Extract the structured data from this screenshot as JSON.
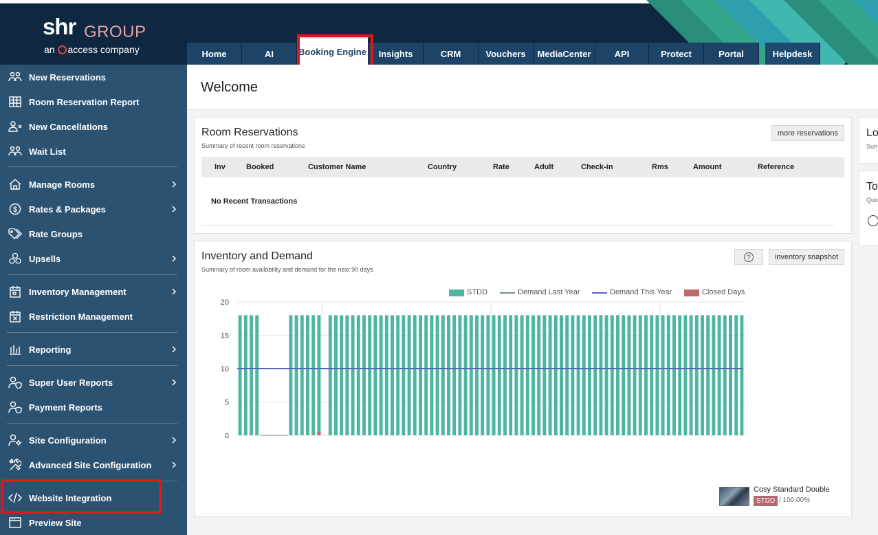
{
  "brand": {
    "name_main": "shr",
    "name_group": "GROUP",
    "tagline_pre": "an",
    "tagline_post": "access company"
  },
  "topnav": {
    "tabs": [
      {
        "label": "Home"
      },
      {
        "label": "AI"
      },
      {
        "label": "Booking Engine",
        "active": true
      },
      {
        "label": "Insights"
      },
      {
        "label": "CRM"
      },
      {
        "label": "Vouchers"
      },
      {
        "label": "MediaCenter"
      },
      {
        "label": "API"
      },
      {
        "label": "Protect"
      },
      {
        "label": "Portal"
      },
      {
        "label": "Helpdesk"
      }
    ]
  },
  "sidebar": {
    "items": [
      {
        "label": "New Reservations",
        "icon": "users-icon",
        "chevron": false
      },
      {
        "label": "Room Reservation Report",
        "icon": "table-icon",
        "chevron": false
      },
      {
        "label": "New Cancellations",
        "icon": "user-x-icon",
        "chevron": false
      },
      {
        "label": "Wait List",
        "icon": "users-icon",
        "chevron": false
      },
      {
        "label": "Manage Rooms",
        "icon": "home-icon",
        "chevron": true
      },
      {
        "label": "Rates & Packages",
        "icon": "dollar-circle-icon",
        "chevron": true
      },
      {
        "label": "Rate Groups",
        "icon": "tag-icon",
        "chevron": false
      },
      {
        "label": "Upsells",
        "icon": "boxes-icon",
        "chevron": true
      },
      {
        "label": "Inventory Management",
        "icon": "calendar-icon",
        "chevron": true
      },
      {
        "label": "Restriction Management",
        "icon": "calendar-x-icon",
        "chevron": false
      },
      {
        "label": "Reporting",
        "icon": "bar-chart-icon",
        "chevron": true
      },
      {
        "label": "Super User Reports",
        "icon": "user-shield-icon",
        "chevron": true
      },
      {
        "label": "Payment Reports",
        "icon": "user-shield-icon",
        "chevron": false
      },
      {
        "label": "Site Configuration",
        "icon": "user-gear-icon",
        "chevron": true
      },
      {
        "label": "Advanced Site Configuration",
        "icon": "tools-icon",
        "chevron": true
      },
      {
        "label": "Website Integration",
        "icon": "code-icon",
        "chevron": false
      },
      {
        "label": "Preview Site",
        "icon": "browser-icon",
        "chevron": false
      }
    ]
  },
  "welcome": {
    "title": "Welcome"
  },
  "reservations": {
    "title": "Room Reservations",
    "subtitle": "Summary of recent room reservations",
    "more_button": "more reservations",
    "columns": [
      "Inv",
      "Booked",
      "Customer Name",
      "Country",
      "Rate",
      "Adult",
      "Check-in",
      "Rms",
      "Amount",
      "Reference"
    ],
    "empty_text": "No Recent Transactions"
  },
  "inventory": {
    "title": "Inventory and Demand",
    "subtitle": "Summary of room availability and demand for the next 90 days",
    "help_icon": "help-circle-icon",
    "snapshot_button": "inventory snapshot",
    "room": {
      "name": "Cosy Standard Double",
      "code": "STDD",
      "percent": "/ 100.00%"
    }
  },
  "right_panels": [
    {
      "title": "Lo",
      "subtitle": "Sun"
    },
    {
      "title": "To",
      "subtitle": "Quic"
    }
  ],
  "colors": {
    "header_bg": "#0d2840",
    "sidebar_bg": "#2c5272",
    "tab_bg": "#1d4467",
    "bar": "#4db6a0",
    "demand_last_year": "#7a8b8a",
    "demand_this_year": "#5565c0",
    "closed_days": "#c06a6e",
    "highlight": "#e3141b"
  },
  "chart_data": {
    "type": "bar",
    "ylim": [
      0,
      20
    ],
    "yticks": [
      0,
      5,
      10,
      15,
      20
    ],
    "grid": true,
    "legend_position": "top-right",
    "series": [
      {
        "name": "STDD",
        "type": "bar",
        "values": [
          18,
          18,
          18,
          18,
          0,
          0,
          0,
          0,
          0,
          18,
          18,
          18,
          18,
          18,
          18,
          0,
          18,
          18,
          18,
          18,
          18,
          18,
          18,
          18,
          18,
          18,
          18,
          18,
          18,
          18,
          18,
          18,
          18,
          18,
          18,
          18,
          18,
          18,
          18,
          18,
          18,
          18,
          18,
          18,
          18,
          18,
          18,
          18,
          18,
          18,
          18,
          18,
          18,
          18,
          18,
          18,
          18,
          18,
          18,
          18,
          18,
          18,
          18,
          18,
          18,
          18,
          18,
          18,
          18,
          18,
          18,
          18,
          18,
          18,
          18,
          18,
          18,
          18,
          18,
          18,
          18,
          18,
          18,
          18,
          18,
          18,
          18,
          18,
          18,
          18
        ]
      },
      {
        "name": "Demand Last Year",
        "type": "line",
        "values": []
      },
      {
        "name": "Demand This Year",
        "type": "line",
        "value": 10
      },
      {
        "name": "Closed Days",
        "type": "bar",
        "values": [
          0,
          0,
          0,
          0,
          0,
          0,
          0,
          0,
          0,
          0,
          0,
          0,
          0,
          0,
          1,
          0,
          0,
          0,
          0,
          0,
          0,
          0,
          0,
          0,
          0,
          0,
          0,
          0,
          0,
          0,
          0,
          0,
          0,
          0,
          0,
          0,
          0,
          0,
          0,
          0,
          0,
          0,
          0,
          0,
          0,
          0,
          0,
          0,
          0,
          0,
          0,
          0,
          0,
          0,
          0,
          0,
          0,
          0,
          0,
          0,
          0,
          0,
          0,
          0,
          0,
          0,
          0,
          0,
          0,
          0,
          0,
          0,
          0,
          0,
          0,
          0,
          0,
          0,
          0,
          0,
          0,
          0,
          0,
          0,
          0,
          0,
          0,
          0,
          0,
          0
        ]
      }
    ]
  }
}
